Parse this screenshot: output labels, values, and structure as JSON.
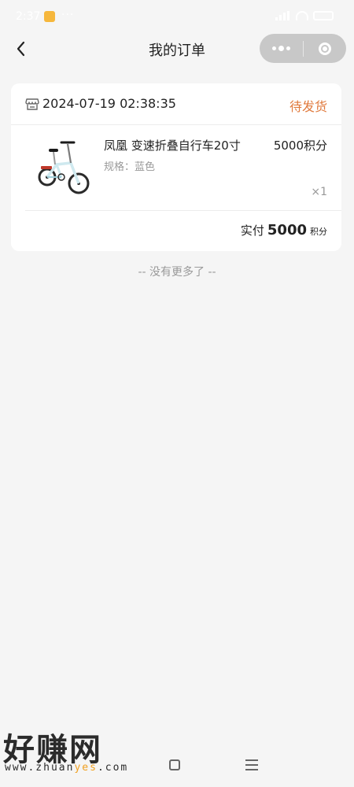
{
  "status_bar": {
    "time": "2:37",
    "dots": "···",
    "signal_icon": "signal-icon",
    "wifi_icon": "wifi-icon",
    "battery_icon": "battery-icon"
  },
  "nav": {
    "title": "我的订单",
    "back_icon": "chevron-left-icon",
    "menu_icon": "more-dots-icon",
    "close_icon": "target-icon"
  },
  "order": {
    "store_icon": "store-icon",
    "datetime": "2024-07-19 02:38:35",
    "status": "待发货",
    "status_color": "#e07a3d",
    "item": {
      "name": "凤凰 变速折叠自行车20寸",
      "spec": "规格：蓝色",
      "price": "5000积分",
      "qty": "×1"
    },
    "total": {
      "label": "实付",
      "amount": "5000",
      "unit": "积分"
    }
  },
  "list_end": "-- 没有更多了 --",
  "watermark": {
    "big": "好赚网",
    "small_a": "www.zhuan",
    "small_hl": "yes",
    "small_b": ".com"
  },
  "colors": {
    "background": "#f5f5f5",
    "card": "#ffffff",
    "accent": "#e07a3d"
  }
}
